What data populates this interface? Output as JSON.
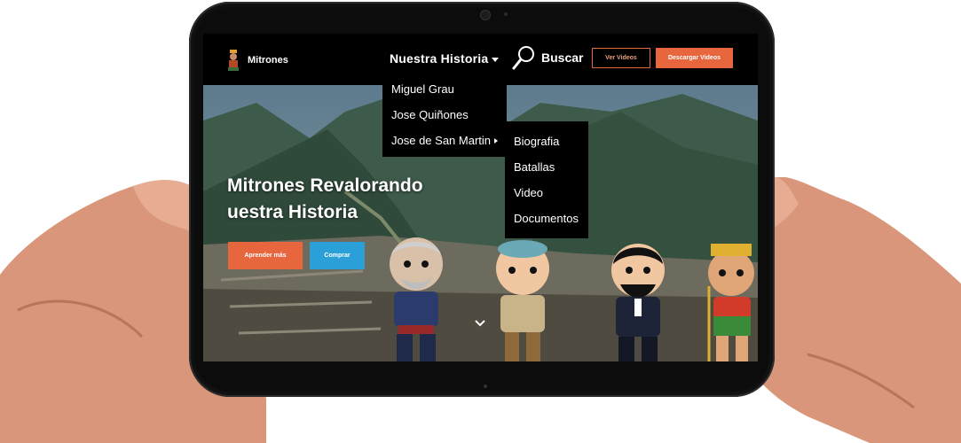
{
  "brand": {
    "name": "Mitrones",
    "logo_icon": "inca-warrior-logo"
  },
  "nav": {
    "historia_label": "Nuestra Historia",
    "search_label": "Buscar",
    "ver_videos_label": "Ver Videos",
    "descargar_videos_label": "Descargar Videos"
  },
  "dropdown": {
    "items": [
      {
        "label": "Miguel Grau"
      },
      {
        "label": "Jose Quiñones"
      },
      {
        "label": "Jose de San Martin"
      }
    ]
  },
  "submenu": {
    "items": [
      {
        "label": "Biografia"
      },
      {
        "label": "Batallas"
      },
      {
        "label": "Video"
      },
      {
        "label": "Documentos"
      }
    ]
  },
  "hero": {
    "title_line1": "Mitrones Revalorando",
    "title_line2": "uestra Historia",
    "aprender_label": "Aprender más",
    "comprar_label": "Comprar"
  },
  "colors": {
    "accent_orange": "#e8663e",
    "accent_blue": "#2b9fd8",
    "nav_bg": "#000000"
  }
}
